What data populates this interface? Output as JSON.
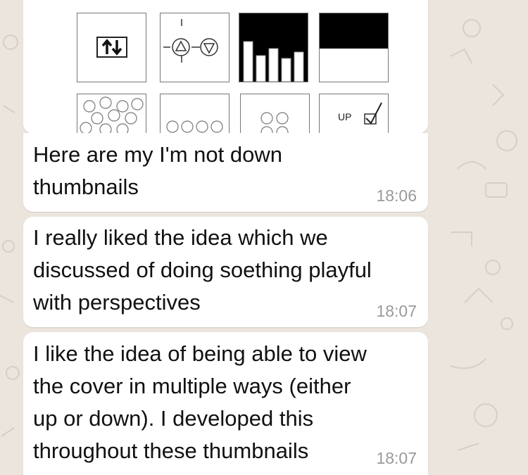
{
  "image_message": {
    "thumbnails_row2": {
      "up_label": "UP"
    },
    "icons": [
      "up-down-arrows-icon",
      "triangle-compass-icon",
      "bar-chart-icon",
      "black-block-icon",
      "smiley-faces-icon",
      "smiley-row-icon",
      "smiley-pair-icon",
      "checkbox-check-icon"
    ]
  },
  "messages": [
    {
      "text_lines": [
        "Here are my I'm not down",
        "thumbnails"
      ],
      "time": "18:06"
    },
    {
      "text_lines": [
        "I really liked the idea which we",
        "discussed of doing soething playful",
        "with perspectives"
      ],
      "time": "18:07"
    },
    {
      "text_lines": [
        "I like the idea of being able to view",
        "the cover in multiple ways (either",
        "up or down). I developed this",
        "throughout these thumbnails"
      ],
      "time": "18:07"
    }
  ],
  "colors": {
    "background": "#ece5dd",
    "bubble": "#ffffff",
    "timestamp": "#9a9a9a"
  }
}
